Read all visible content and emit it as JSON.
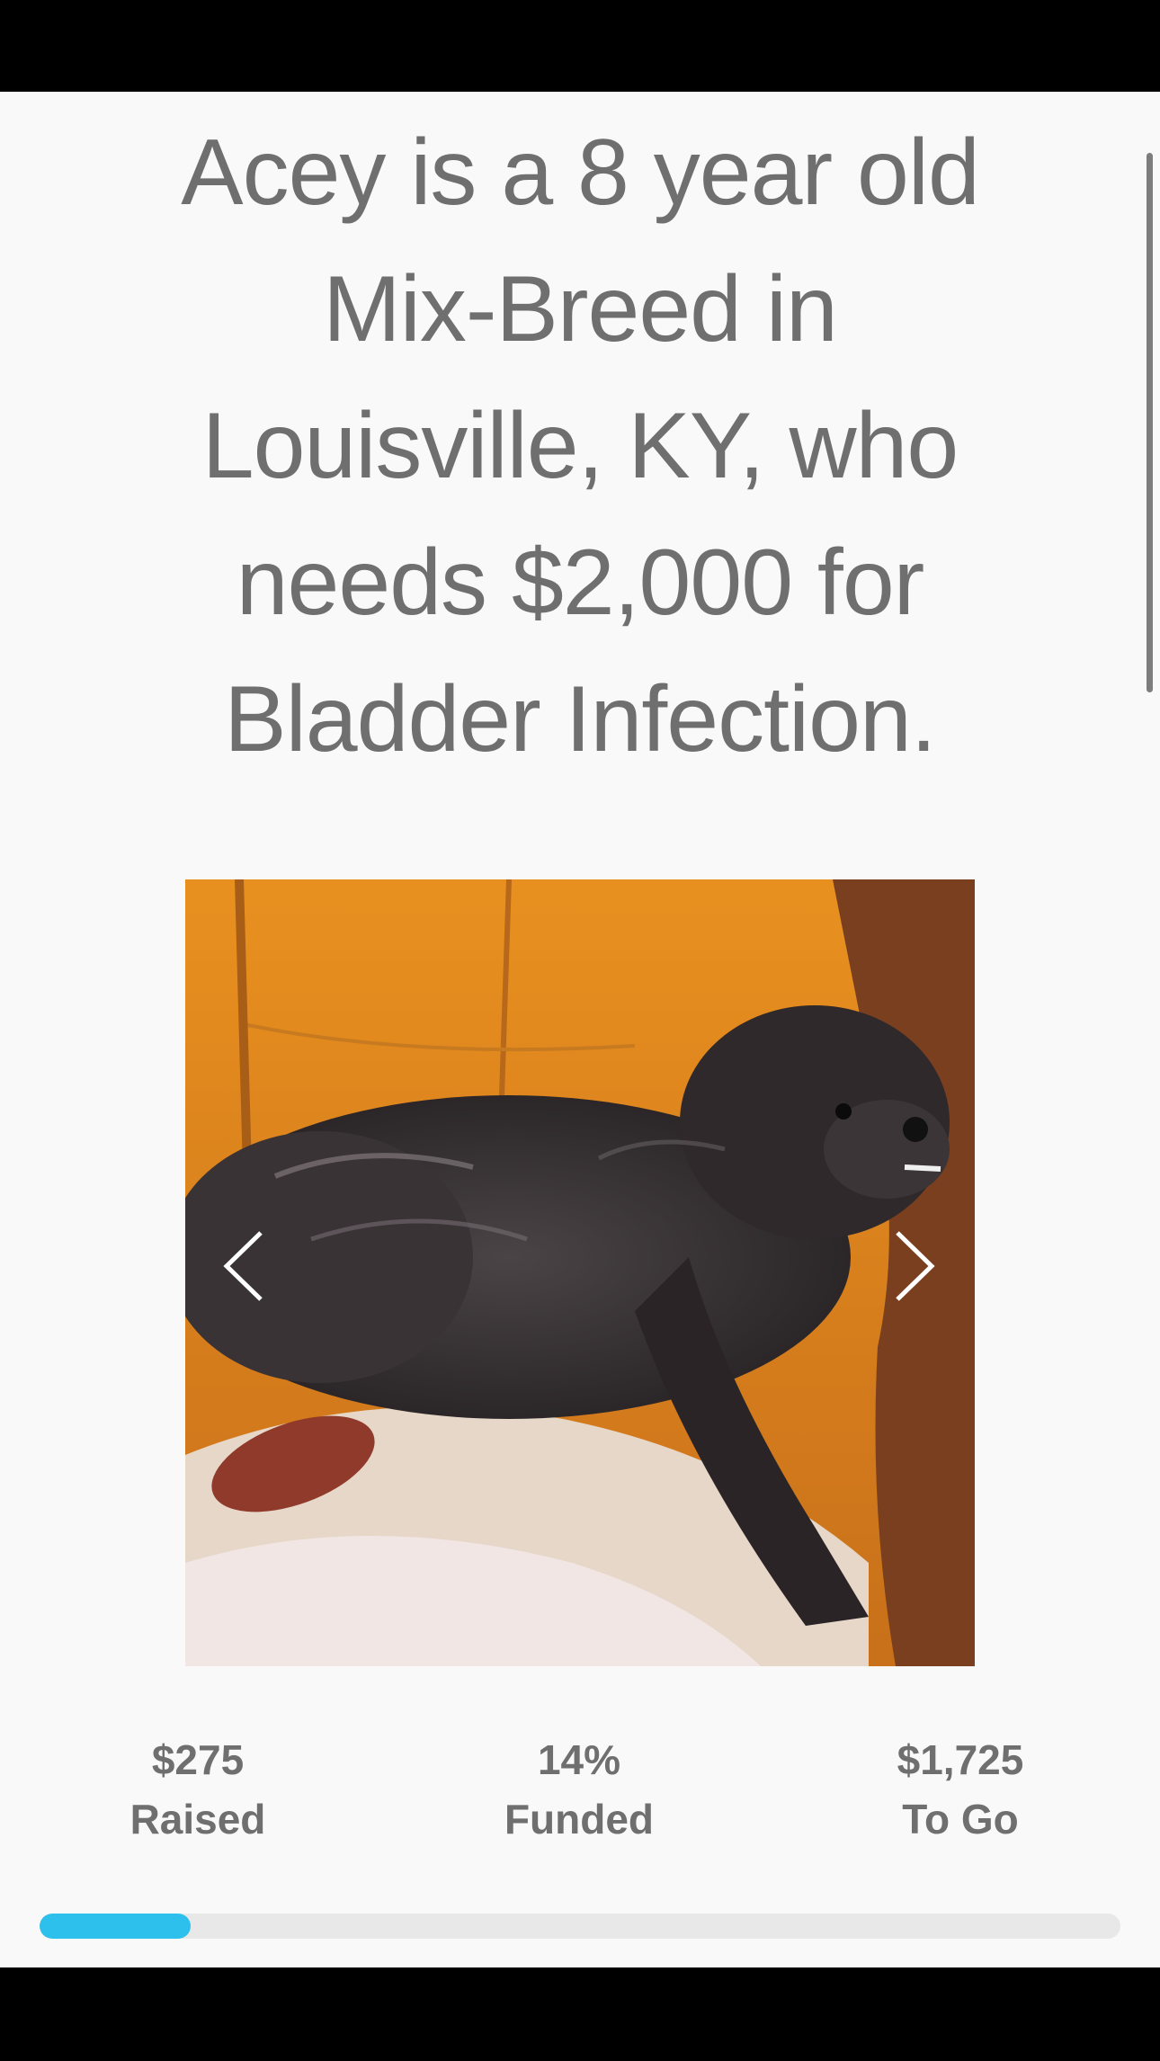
{
  "campaign": {
    "headline": "Acey is a 8 year old Mix-Breed in Louisville, KY, who needs $2,000 for Bladder Infection.",
    "gallery": {
      "prev_icon": "chevron-left-icon",
      "next_icon": "chevron-right-icon"
    },
    "stats": {
      "raised_amount": "$275",
      "raised_label": "Raised",
      "funded_percent": "14%",
      "funded_label": "Funded",
      "togo_amount": "$1,725",
      "togo_label": "To Go"
    },
    "progress": {
      "fraction": 0.14,
      "fill_color": "#2ec0ec",
      "track_color": "#e8e8e8"
    }
  }
}
